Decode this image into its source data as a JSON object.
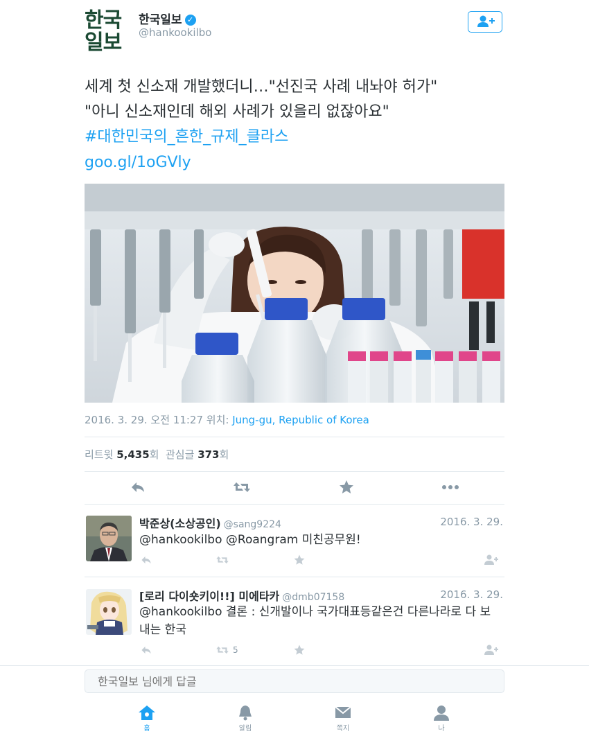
{
  "author": {
    "logo_line1": "한국",
    "logo_line2": "일보",
    "name": "한국일보",
    "verified_mark": "✓",
    "handle": "@hankookilbo"
  },
  "tweet": {
    "line1": "세계 첫 신소재 개발했더니…\"선진국 사례 내놔야 허가\"",
    "line2": "\"아니 신소재인데 해외 사례가 있을리 없잖아요\"",
    "hashtag": "#대한민국의_흔한_규제_클라스",
    "link": "goo.gl/1oGVly",
    "timestamp": "2016. 3. 29. 오전 11:27 위치:",
    "location": "Jung-gu, Republic of Korea",
    "retweet_label": "리트윗",
    "retweet_count": "5,435",
    "count_suffix_1": "회",
    "like_label": "관심글",
    "like_count": "373",
    "count_suffix_2": "회"
  },
  "replies": [
    {
      "name": "박준상(소상공인)",
      "handle": "@sang9224",
      "date": "2016. 3. 29.",
      "text": "@hankookilbo @Roangram 미친공무원!"
    },
    {
      "name": "[로리 다이숏키이!!] 미에타카",
      "handle": "@dmb07158",
      "date": "2016. 3. 29.",
      "text_line1": "@hankookilbo 결론 : 신개발이나 국가대표등같은건 다른나라로 다 보",
      "text_line2": "내는 한국",
      "retweet_count": "5"
    }
  ],
  "reply_box": {
    "placeholder": "한국일보 님에게 답글"
  },
  "tabs": [
    {
      "label": "홈"
    },
    {
      "label": "알림"
    },
    {
      "label": "쪽지"
    },
    {
      "label": "나"
    }
  ],
  "colors": {
    "accent": "#1da1f2",
    "logo_green": "#1b4a33",
    "muted": "#8899a6"
  }
}
